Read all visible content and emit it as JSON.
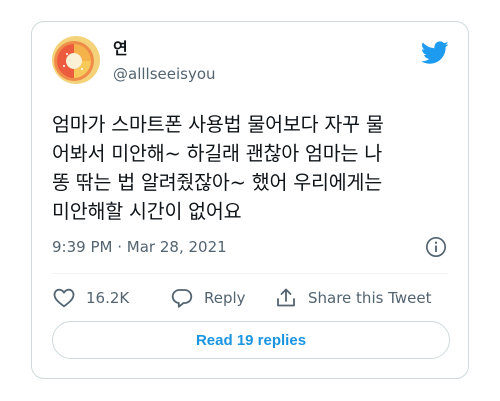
{
  "colors": {
    "accent": "#1d9bf0",
    "text": "#0f1419",
    "muted": "#536471",
    "border": "#cfd9de"
  },
  "author": {
    "display_name": "연",
    "handle": "@alllseeisyou",
    "avatar_icon": "peach-ring-candy-avatar"
  },
  "tweet": {
    "lines": [
      "엄마가 스마트폰 사용법 물어보다 자꾸 물",
      "어봐서 미안해~ 하길래 괜찮아 엄마는 나",
      "똥 딲는 법 알려줬잖아~ 했어 우리에게는",
      "미안해할 시간이 없어요"
    ],
    "time": "9:39 PM",
    "separator": "·",
    "date": "Mar 28, 2021"
  },
  "actions": {
    "like_count": "16.2K",
    "reply_label": "Reply",
    "share_label": "Share this Tweet"
  },
  "read_replies_label": "Read 19 replies"
}
